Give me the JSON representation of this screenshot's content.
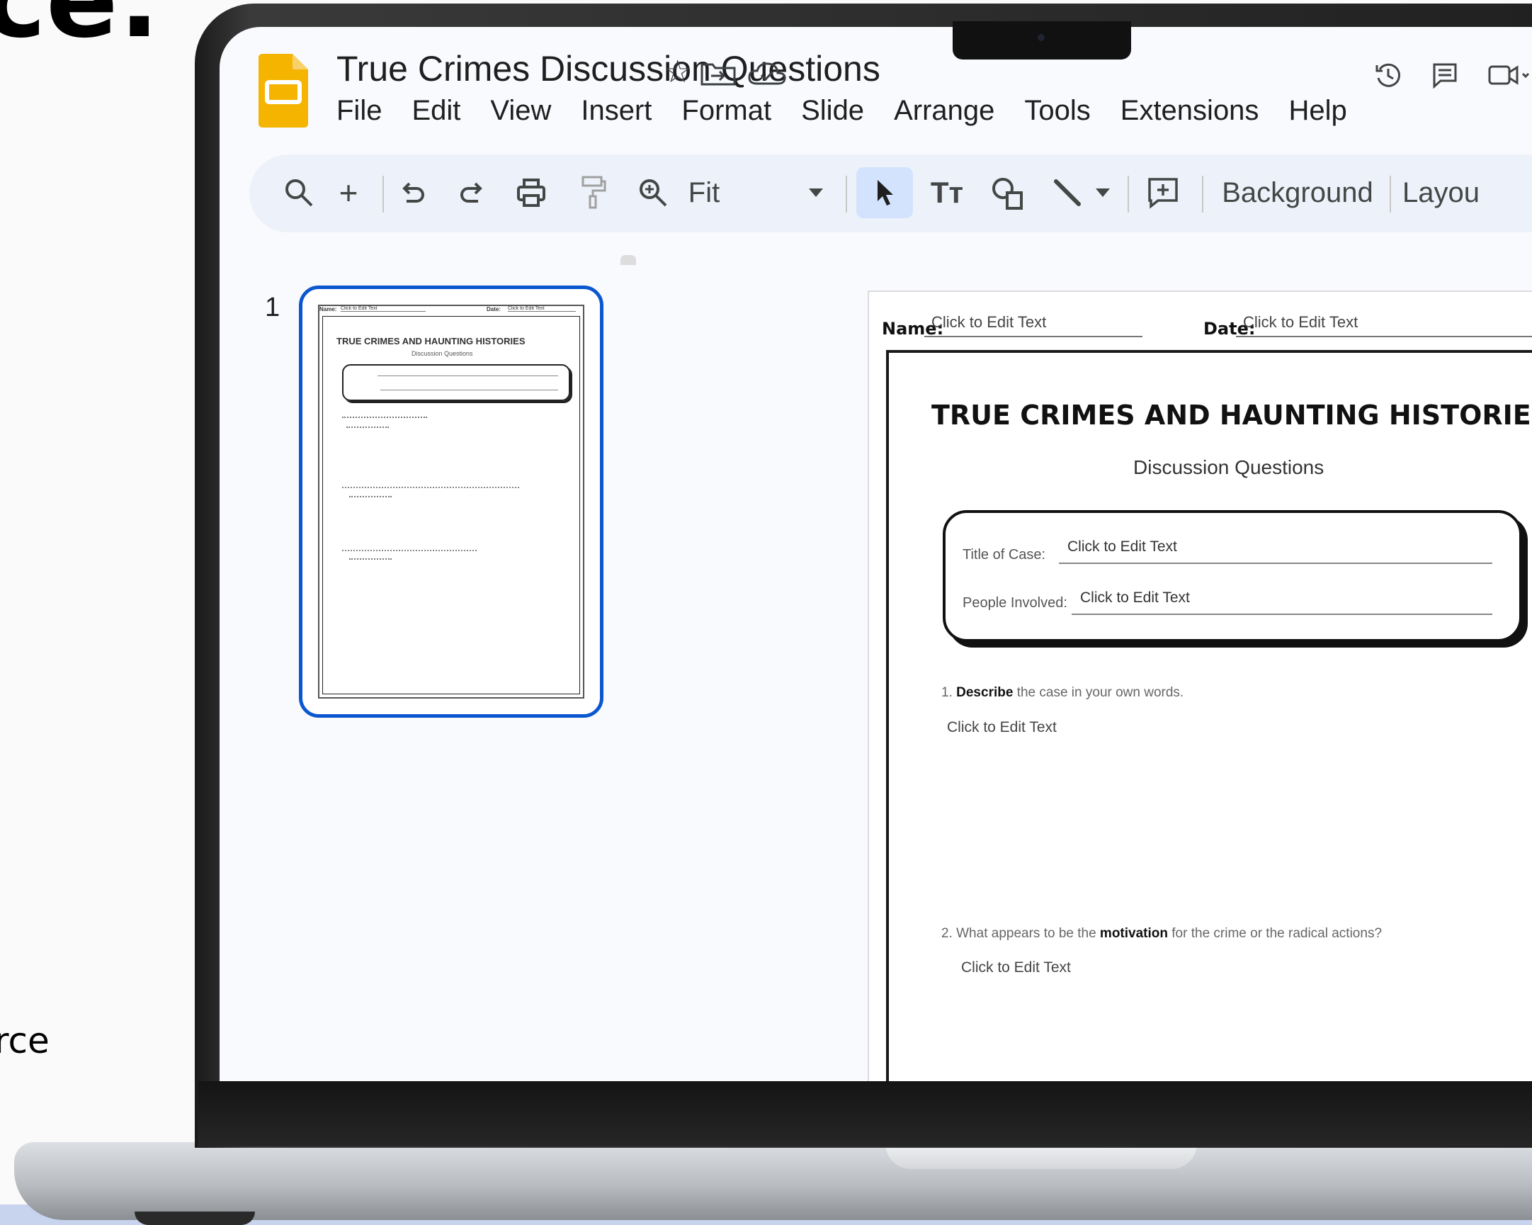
{
  "backdrop": {
    "headline_fragment": "ce:",
    "side_text_fragment": "rce"
  },
  "app": {
    "doc_title": "True Crimes Discussion Questions",
    "menu": [
      "File",
      "Edit",
      "View",
      "Insert",
      "Format",
      "Slide",
      "Arrange",
      "Tools",
      "Extensions",
      "Help"
    ],
    "title_icons": [
      "star-icon",
      "move-to-folder-icon",
      "cloud-saved-icon"
    ],
    "right_icons": [
      "version-history-icon",
      "comments-icon",
      "meet-icon"
    ]
  },
  "toolbar": {
    "zoom_label": "Fit",
    "background_label": "Background",
    "layout_label": "Layou"
  },
  "filmstrip": {
    "slide_number": "1"
  },
  "slide": {
    "name_label": "Name:",
    "name_value": "Click to Edit Text",
    "date_label": "Date:",
    "date_value": "Click to Edit Text",
    "title": "TRUE CRIMES AND HAUNTING HISTORIES",
    "subtitle": "Discussion Questions",
    "case_title_label": "Title of Case:",
    "case_title_value": "Click to Edit Text",
    "people_label": "People Involved:",
    "people_value": "Click to Edit Text",
    "q1_prefix": "1.",
    "q1_bold": "Describe",
    "q1_rest": "the case in your own words.",
    "q1_answer": "Click to Edit Text",
    "q2_prefix": "2. What appears to be the",
    "q2_bold": "motivation",
    "q2_rest": "for the crime or the radical actions?",
    "q2_answer": "Click to Edit Text"
  },
  "colors": {
    "accent_blue": "#0b57d0",
    "slides_yellow": "#f4b400",
    "toolbar_bg": "#edf2fa"
  }
}
